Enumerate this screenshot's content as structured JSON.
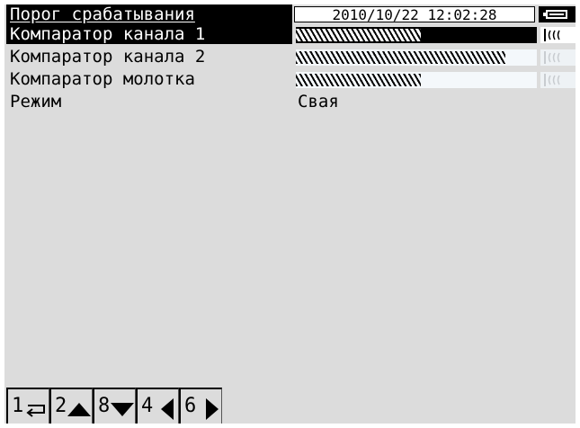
{
  "header": {
    "title": "Порог срабатывания",
    "datetime": "2010/10/22 12:02:28",
    "battery_icon": "battery-icon"
  },
  "rows": [
    {
      "label": "Компаратор канала 1",
      "level": 0.52,
      "selected": true,
      "icon": "sound-wave-icon"
    },
    {
      "label": "Компаратор канала 2",
      "level": 0.87,
      "selected": false,
      "icon": "sound-wave-icon"
    },
    {
      "label": "Компаратор молотка",
      "level": 0.52,
      "selected": false,
      "icon": "sound-wave-icon"
    }
  ],
  "mode": {
    "label": "Режим",
    "value": "Свая"
  },
  "softkeys": [
    {
      "number": "1",
      "icon": "return-arrow-icon"
    },
    {
      "number": "2",
      "icon": "up-triangle-icon"
    },
    {
      "number": "8",
      "icon": "down-triangle-icon"
    },
    {
      "number": "4",
      "icon": "left-triangle-icon"
    },
    {
      "number": "6",
      "icon": "right-triangle-icon"
    }
  ],
  "colors": {
    "background": "#dcdcdc",
    "highlight": "#000000",
    "bar_background": "#f4f8fb"
  }
}
